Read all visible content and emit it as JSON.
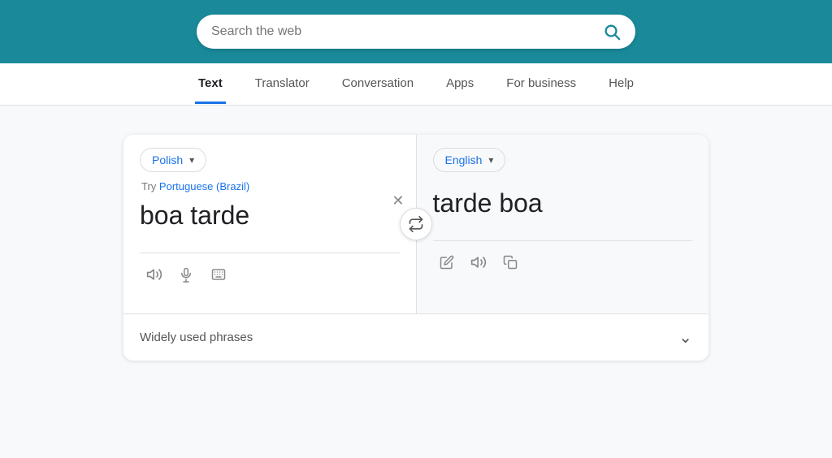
{
  "header": {
    "search_placeholder": "Search the web",
    "bg_color": "#1a8a9a"
  },
  "nav": {
    "items": [
      {
        "id": "text",
        "label": "Text",
        "active": true
      },
      {
        "id": "translator",
        "label": "Translator",
        "active": false
      },
      {
        "id": "conversation",
        "label": "Conversation",
        "active": false
      },
      {
        "id": "apps",
        "label": "Apps",
        "active": false
      },
      {
        "id": "for-business",
        "label": "For business",
        "active": false
      },
      {
        "id": "help",
        "label": "Help",
        "active": false
      }
    ]
  },
  "translator": {
    "source_lang": "Polish",
    "target_lang": "English",
    "suggestion_prefix": "Try",
    "suggestion_lang": "Portuguese (Brazil)",
    "source_text": "boa tarde",
    "target_text": "tarde boa",
    "phrases_label": "Widely used phrases",
    "icons": {
      "speaker": "🔊",
      "mic": "🎤",
      "keyboard": "⌨",
      "edit": "✏",
      "copy": "📋"
    }
  }
}
